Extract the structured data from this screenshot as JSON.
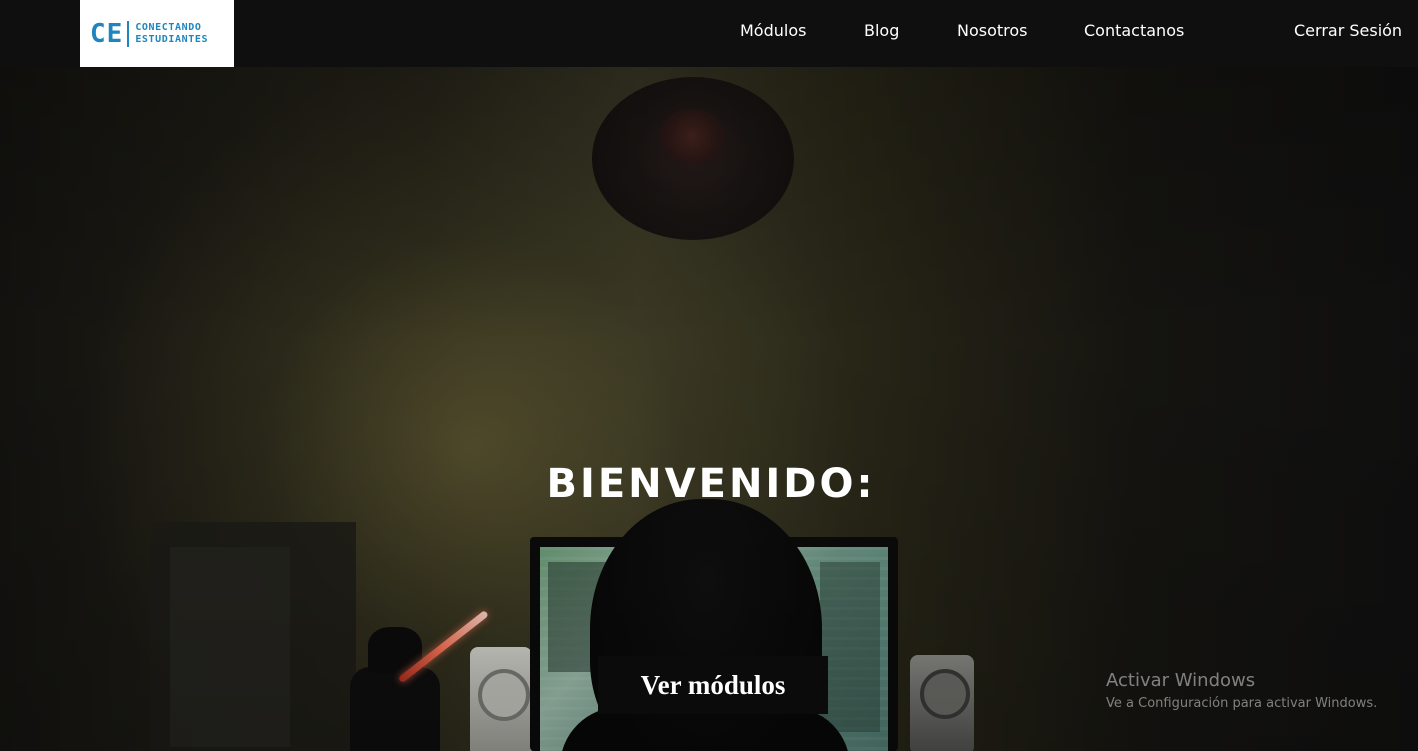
{
  "brand": {
    "logo_mark": "CE",
    "logo_line1": "CONECTANDO",
    "logo_line2": "ESTUDIANTES",
    "color": "#1f86bd"
  },
  "nav": {
    "items": [
      {
        "label": "Módulos"
      },
      {
        "label": "Blog"
      },
      {
        "label": "Nosotros"
      },
      {
        "label": "Contactanos"
      }
    ],
    "logout_label": "Cerrar Sesión"
  },
  "hero": {
    "title": "BIENVENIDO:",
    "cta_label": "Ver módulos"
  },
  "watermark": {
    "title": "Activar Windows",
    "subtitle": "Ve a Configuración para activar Windows."
  }
}
